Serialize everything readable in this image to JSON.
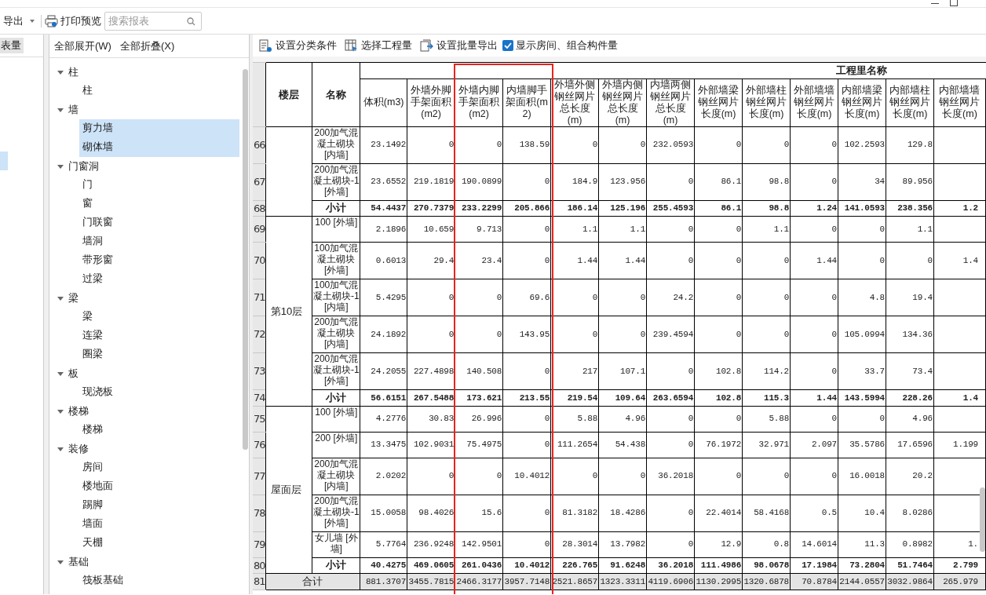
{
  "toolbar": {
    "export": "导出",
    "print_preview": "打印预览",
    "search": {
      "placeholder": "搜索报表"
    }
  },
  "left_panel": {
    "tab": "表量",
    "items": [
      {
        "selected": true
      }
    ]
  },
  "tree_panel": {
    "expand_all": "全部展开(W)",
    "collapse_all": "全部折叠(X)",
    "items": [
      {
        "label": "柱",
        "expanded": true,
        "children": [
          {
            "label": "柱",
            "selected": false
          }
        ]
      },
      {
        "label": "墙",
        "expanded": true,
        "children": [
          {
            "label": "剪力墙",
            "selected": true
          },
          {
            "label": "砌体墙",
            "selected": true
          }
        ]
      },
      {
        "label": "门窗洞",
        "expanded": true,
        "children": [
          {
            "label": "门",
            "selected": false
          },
          {
            "label": "窗",
            "selected": false
          },
          {
            "label": "门联窗",
            "selected": false
          },
          {
            "label": "墙洞",
            "selected": false
          },
          {
            "label": "带形窗",
            "selected": false
          },
          {
            "label": "过梁",
            "selected": false
          }
        ]
      },
      {
        "label": "梁",
        "expanded": true,
        "children": [
          {
            "label": "梁",
            "selected": false
          },
          {
            "label": "连梁",
            "selected": false
          },
          {
            "label": "圈梁",
            "selected": false
          }
        ]
      },
      {
        "label": "板",
        "expanded": true,
        "children": [
          {
            "label": "现浇板",
            "selected": false
          }
        ]
      },
      {
        "label": "楼梯",
        "expanded": true,
        "children": [
          {
            "label": "楼梯",
            "selected": false
          }
        ]
      },
      {
        "label": "装修",
        "expanded": true,
        "children": [
          {
            "label": "房间",
            "selected": false
          },
          {
            "label": "楼地面",
            "selected": false
          },
          {
            "label": "踢脚",
            "selected": false
          },
          {
            "label": "墙面",
            "selected": false
          },
          {
            "label": "天棚",
            "selected": false
          }
        ]
      },
      {
        "label": "基础",
        "expanded": true,
        "children": [
          {
            "label": "筏板基础",
            "selected": false
          }
        ]
      }
    ]
  },
  "report_toolbar": {
    "buttons": [
      "设置分类条件",
      "选择工程量",
      "设置批量导出"
    ],
    "show_rooms": {
      "label": "显示房间、组合构件量",
      "checked": true
    }
  },
  "table": {
    "floor_header": "楼层",
    "name_header": "名称",
    "group_header": "工程里名称",
    "columns": [
      {
        "label": "体积(m3)",
        "highlighted": false
      },
      {
        "label": "外墙外脚手架面积(m2)",
        "highlighted": false
      },
      {
        "label": "外墙内脚手架面积(m2)",
        "highlighted": true
      },
      {
        "label": "内墙脚手架面积(m2)",
        "highlighted": true
      },
      {
        "label": "外墙外侧钢丝网片总长度(m)",
        "highlighted": false
      },
      {
        "label": "外墙内侧钢丝网片总长度(m)",
        "highlighted": false
      },
      {
        "label": "内墙两侧钢丝网片总长度(m)",
        "highlighted": false
      },
      {
        "label": "外部墙梁钢丝网片长度(m)",
        "highlighted": false
      },
      {
        "label": "外部墙柱钢丝网片长度(m)",
        "highlighted": false
      },
      {
        "label": "外部墙墙钢丝网片长度(m)",
        "highlighted": false
      },
      {
        "label": "内部墙梁钢丝网片长度(m)",
        "highlighted": false
      },
      {
        "label": "内部墙柱钢丝网片长度(m)",
        "highlighted": false
      },
      {
        "label": "内部墙墙钢丝网片长度(m)",
        "highlighted": false
      }
    ],
    "groups": [
      {
        "rows": [
          {
            "num": "66",
            "kind": "item",
            "name": "200加气混凝土砌块[内墙]",
            "values": [
              "23.1492",
              "0",
              "0",
              "138.59",
              "0",
              "0",
              "232.0593",
              "0",
              "0",
              "0",
              "102.2593",
              "129.8"
            ]
          },
          {
            "num": "67",
            "kind": "item",
            "name": "200加气混凝土砌块-1 [外墙]",
            "values": [
              "23.6552",
              "219.1819",
              "190.0899",
              "0",
              "184.9",
              "123.956",
              "0",
              "86.1",
              "98.8",
              "0",
              "34",
              "89.956"
            ]
          },
          {
            "num": "68",
            "kind": "subtotal",
            "name": "小计",
            "values": [
              "54.4437",
              "270.7379",
              "233.2299",
              "205.866",
              "186.14",
              "125.196",
              "255.4593",
              "86.1",
              "98.8",
              "1.24",
              "141.0593",
              "238.356",
              "1.2"
            ]
          }
        ]
      },
      {
        "floor": "第10层",
        "rows": [
          {
            "num": "69",
            "kind": "item",
            "name": "100 [外墙]",
            "values": [
              "2.1896",
              "10.659",
              "9.713",
              "0",
              "1.1",
              "1.1",
              "0",
              "0",
              "1.1",
              "0",
              "0",
              "1.1"
            ]
          },
          {
            "num": "70",
            "kind": "item",
            "name": "100加气混凝土砌块[外墙]",
            "values": [
              "0.6013",
              "29.4",
              "23.4",
              "0",
              "1.44",
              "1.44",
              "0",
              "0",
              "0",
              "1.44",
              "0",
              "0",
              "1.4"
            ]
          },
          {
            "num": "71",
            "kind": "item",
            "name": "100加气混凝土砌块-1 [内墙]",
            "values": [
              "5.4295",
              "0",
              "0",
              "69.6",
              "0",
              "0",
              "24.2",
              "0",
              "0",
              "0",
              "4.8",
              "19.4"
            ]
          },
          {
            "num": "72",
            "kind": "item",
            "name": "200加气混凝土砌块[内墙]",
            "values": [
              "24.1892",
              "0",
              "0",
              "143.95",
              "0",
              "0",
              "239.4594",
              "0",
              "0",
              "0",
              "105.0994",
              "134.36"
            ]
          },
          {
            "num": "73",
            "kind": "item",
            "name": "200加气混凝土砌块-1 [外墙]",
            "values": [
              "24.2055",
              "227.4898",
              "140.508",
              "0",
              "217",
              "107.1",
              "0",
              "102.8",
              "114.2",
              "0",
              "33.7",
              "73.4"
            ]
          },
          {
            "num": "74",
            "kind": "subtotal",
            "name": "小计",
            "values": [
              "56.6151",
              "267.5488",
              "173.621",
              "213.55",
              "219.54",
              "109.64",
              "263.6594",
              "102.8",
              "115.3",
              "1.44",
              "143.5994",
              "228.26",
              "1.4"
            ]
          }
        ]
      },
      {
        "floor": "屋面层",
        "rows": [
          {
            "num": "75",
            "kind": "item",
            "name": "100 [外墙]",
            "values": [
              "4.2776",
              "30.83",
              "26.996",
              "0",
              "5.88",
              "4.96",
              "0",
              "0",
              "5.88",
              "0",
              "0",
              "4.96"
            ]
          },
          {
            "num": "76",
            "kind": "item",
            "name": "200 [外墙]",
            "values": [
              "13.3475",
              "102.9031",
              "75.4975",
              "0",
              "111.2654",
              "54.438",
              "0",
              "76.1972",
              "32.971",
              "2.097",
              "35.5786",
              "17.6596",
              "1.199"
            ]
          },
          {
            "num": "77",
            "kind": "item",
            "name": "200加气混凝土砌块[内墙]",
            "values": [
              "2.0202",
              "0",
              "0",
              "10.4012",
              "0",
              "0",
              "36.2018",
              "0",
              "0",
              "0",
              "16.0018",
              "20.2"
            ]
          },
          {
            "num": "78",
            "kind": "item",
            "name": "200加气混凝土砌块-1 [外墙]",
            "values": [
              "15.0058",
              "98.4026",
              "15.6",
              "0",
              "81.3182",
              "18.4286",
              "0",
              "22.4014",
              "58.4168",
              "0.5",
              "10.4",
              "8.0286"
            ]
          },
          {
            "num": "79",
            "kind": "item",
            "name": "女儿墙 [外墙]",
            "values": [
              "5.7764",
              "236.9248",
              "142.9501",
              "0",
              "28.3014",
              "13.7982",
              "0",
              "12.9",
              "0.8",
              "14.6014",
              "11.3",
              "0.8982",
              "1."
            ]
          },
          {
            "num": "80",
            "kind": "subtotal",
            "name": "小计",
            "values": [
              "40.4275",
              "469.0605",
              "261.0436",
              "10.4012",
              "226.765",
              "91.6248",
              "36.2018",
              "111.4986",
              "98.0678",
              "17.1984",
              "73.2804",
              "51.7464",
              "2.799"
            ]
          }
        ]
      }
    ],
    "total": {
      "num": "81",
      "label": "合计",
      "values": [
        "881.3707",
        "3455.7815",
        "2466.3177",
        "3957.7148",
        "2521.8657",
        "1323.3311",
        "4119.6906",
        "1130.2995",
        "1320.6878",
        "70.8784",
        "2144.0557",
        "3032.9864",
        "265.979"
      ]
    }
  }
}
